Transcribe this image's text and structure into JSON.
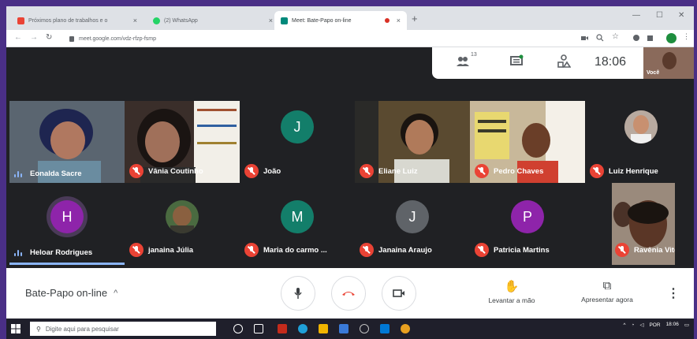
{
  "browser": {
    "tabs": [
      {
        "title": "Próximos plano de trabalhos e o",
        "icon": "gmail-icon"
      },
      {
        "title": "(2) WhatsApp",
        "icon": "whatsapp-icon"
      },
      {
        "title": "Meet: Bate-Papo on-line",
        "icon": "meet-icon",
        "active": true
      }
    ],
    "url": "meet.google.com/vdz-rfzp-fsmp"
  },
  "topbar": {
    "participant_count": "13",
    "time": "18:06",
    "self_label": "Você"
  },
  "participants": [
    {
      "name": "Eonalda Sacre",
      "audio": "speaking",
      "tile": "video"
    },
    {
      "name": "Vânia Coutinho",
      "audio": "muted",
      "tile": "video"
    },
    {
      "name": "João",
      "audio": "muted",
      "tile": "avatar",
      "initial": "J",
      "color": "#137e6a"
    },
    {
      "name": "Eliane Luiz",
      "audio": "muted",
      "tile": "video"
    },
    {
      "name": "Pedro Chaves",
      "audio": "muted",
      "tile": "video"
    },
    {
      "name": "Luiz Henrique",
      "audio": "muted",
      "tile": "photo"
    },
    {
      "name": "Heloar Rodrigues",
      "audio": "speaking",
      "tile": "avatar",
      "initial": "H",
      "color": "#8e24aa"
    },
    {
      "name": "janaina Júlia",
      "audio": "muted",
      "tile": "photo"
    },
    {
      "name": "Maria do carmo ...",
      "audio": "muted",
      "tile": "avatar",
      "initial": "M",
      "color": "#137e6a"
    },
    {
      "name": "Janaina Araujo",
      "audio": "muted",
      "tile": "avatar",
      "initial": "J",
      "color": "#5f6368"
    },
    {
      "name": "Patricia Martins",
      "audio": "muted",
      "tile": "avatar",
      "initial": "P",
      "color": "#8e24aa"
    },
    {
      "name": "Ravênia Vitória",
      "audio": "muted",
      "tile": "video"
    }
  ],
  "controls": {
    "meeting_title": "Bate-Papo on-line",
    "raise_hand": "Levantar a mão",
    "present_now": "Apresentar agora"
  },
  "taskbar": {
    "search_placeholder": "Digite aqui para pesquisar",
    "lang": "POR",
    "time": "18:06"
  },
  "colors": {
    "meet_bg": "#202124",
    "muted_red": "#ea4335",
    "end_call": "#ea4335",
    "speaking_blue": "#8ab4f8"
  }
}
